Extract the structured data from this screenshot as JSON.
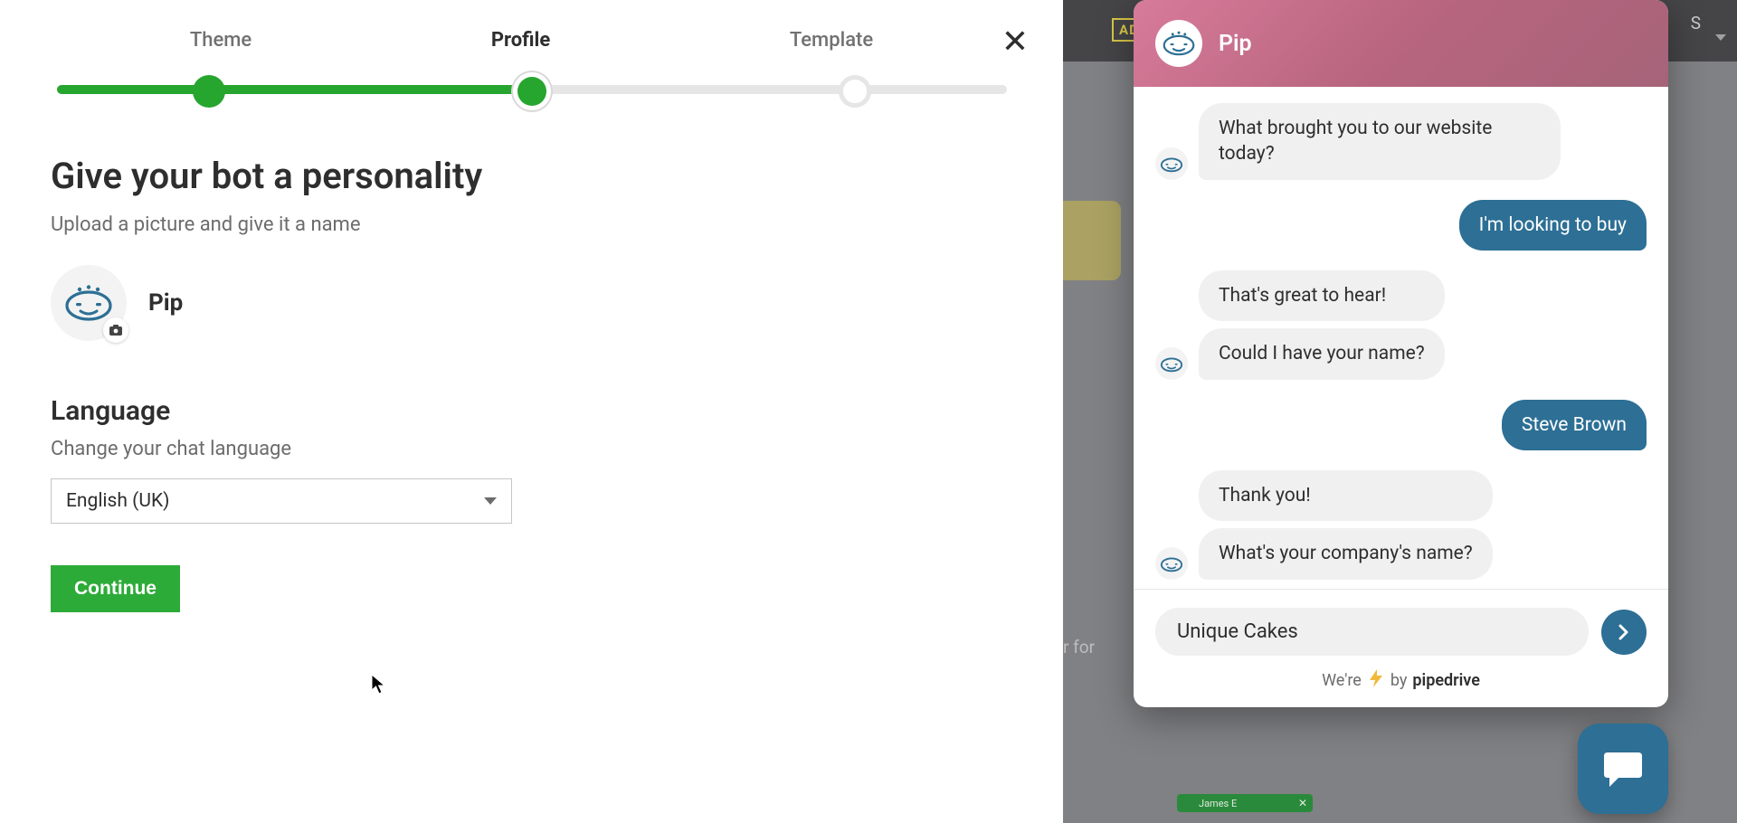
{
  "stepper": {
    "steps": [
      "Theme",
      "Profile",
      "Template"
    ],
    "active_index": 1
  },
  "close_label": "✕",
  "page": {
    "title": "Give your bot a personality",
    "subtitle": "Upload a picture and give it a name",
    "bot_name": "Pip"
  },
  "language": {
    "title": "Language",
    "subtitle": "Change your chat language",
    "selected": "English (UK)"
  },
  "continue_label": "Continue",
  "chat": {
    "title": "Pip",
    "messages": {
      "m0_bot": "What brought you to our website today?",
      "m1_user": "I'm looking to buy",
      "m2_bot_a": "That's great to hear!",
      "m2_bot_b": "Could I have your name?",
      "m3_user": "Steve Brown",
      "m4_bot_a": "Thank you!",
      "m4_bot_b": "What's your company's name?"
    },
    "input_value": "Unique Cakes",
    "footer_pre": "We're",
    "footer_mid": "by",
    "footer_brand": "pipedrive"
  },
  "bg": {
    "adv": "AD\\",
    "s": "S",
    "text_fragment": "r for",
    "card_name": "James E"
  }
}
